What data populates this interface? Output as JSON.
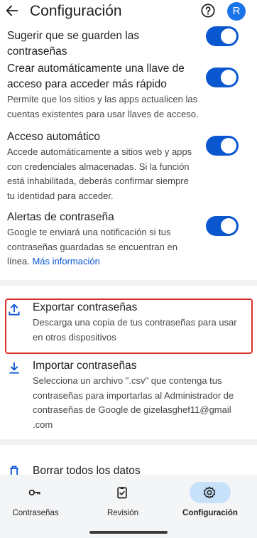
{
  "header": {
    "title": "Configuración",
    "avatar_letter": "R"
  },
  "settings": {
    "suggest_save": {
      "title": "Sugerir que se guarden las contraseñas",
      "enabled": true
    },
    "passkeys": {
      "title": "Crear automáticamente una llave de acceso para acceder más rápido",
      "desc": "Permite que los sitios y las apps actualicen las cuentas existentes para usar llaves de acceso.",
      "enabled": true
    },
    "auto_signin": {
      "title": "Acceso automático",
      "desc": "Accede automáticamente a sitios web y apps con credenciales almacenadas. Si la función está inhabilitada, deberás confirmar siempre tu identidad para acceder.",
      "enabled": true
    },
    "alerts": {
      "title": "Alertas de contraseña",
      "desc": "Google te enviará una notificación si tus contraseñas guardadas se encuentran en línea.",
      "link": "Más información",
      "enabled": true
    }
  },
  "actions": {
    "export": {
      "title": "Exportar contraseñas",
      "desc": "Descarga una copia de tus contraseñas para usar en otros dispositivos"
    },
    "import": {
      "title": "Importar contraseñas",
      "desc": "Selecciona un archivo \".csv\" que contenga tus contraseñas para importarlas al Administrador de contraseñas de Google de gizelasghef11@gmail .com"
    },
    "delete_all": {
      "title": "Borrar todos los datos"
    }
  },
  "bottom_nav": {
    "items": [
      {
        "label": "Contraseñas",
        "icon": "key-icon",
        "active": false
      },
      {
        "label": "Revisión",
        "icon": "clipboard-check-icon",
        "active": false
      },
      {
        "label": "Configuración",
        "icon": "gear-icon",
        "active": true
      }
    ]
  },
  "colors": {
    "accent": "#0b57d0",
    "highlight": "#d93025",
    "nav_active_pill": "#c8e1fb"
  }
}
